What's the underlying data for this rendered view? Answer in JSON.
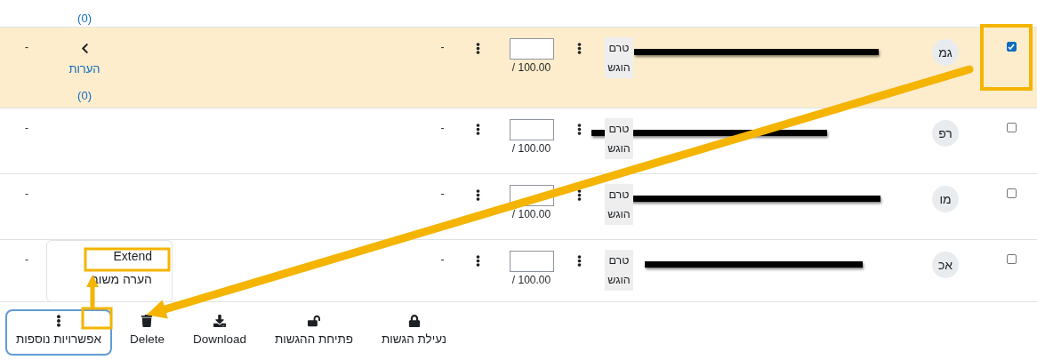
{
  "top_row": {
    "comments_count": "(0)"
  },
  "rows": [
    {
      "selected": true,
      "initials": "גמ",
      "status": "טרם הוגש",
      "grade_max": "/ 100.00",
      "column_8": "-",
      "comments": {
        "label": "הערות",
        "count": "(0)"
      },
      "column_last": "-"
    },
    {
      "selected": false,
      "initials": "רפ",
      "status": "טרם הוגש",
      "grade_max": "/ 100.00",
      "column_8": "-",
      "column_last": "-"
    },
    {
      "selected": false,
      "initials": "מו",
      "status": "טרם הוגש",
      "grade_max": "/ 100.00",
      "column_8": "-",
      "column_last": "-"
    },
    {
      "selected": false,
      "initials": "אכ",
      "status": "טרם הוגש",
      "grade_max": "/ 100.00",
      "column_8": "-",
      "column_last": "-"
    }
  ],
  "menu": {
    "items": [
      {
        "label": "Extend"
      },
      {
        "label": "הערה משוב"
      }
    ]
  },
  "toolbar": [
    {
      "kind": "lock",
      "label": "נעילת הגשות",
      "focused": false
    },
    {
      "kind": "unlock",
      "label": "פתיחת ההגשות",
      "focused": false
    },
    {
      "kind": "download",
      "label": "Download",
      "focused": false
    },
    {
      "kind": "delete",
      "label": "Delete",
      "focused": false
    },
    {
      "kind": "more",
      "label": "אפשרויות נוספות",
      "focused": true
    }
  ]
}
